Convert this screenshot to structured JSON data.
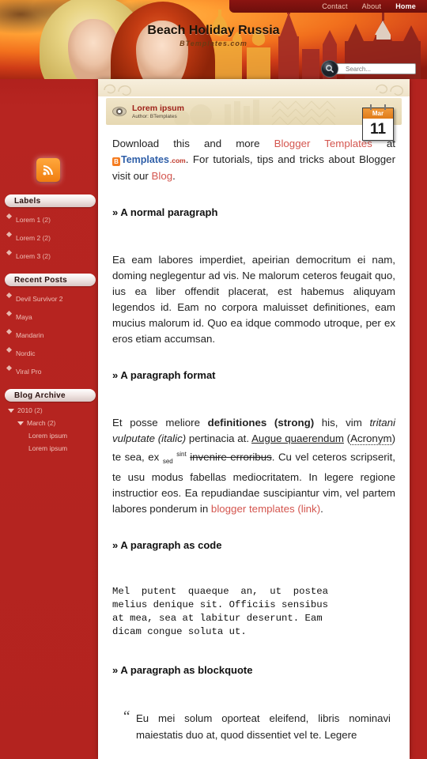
{
  "topnav": {
    "items": [
      {
        "label": "Contact",
        "active": false
      },
      {
        "label": "About",
        "active": false
      },
      {
        "label": "Home",
        "active": true
      }
    ]
  },
  "header": {
    "blog_title": "Beach Holiday Russia",
    "blog_subtitle": "BTemplates.com",
    "search_placeholder": "Search...",
    "search_value": "",
    "rss_icon": "rss-icon",
    "search_icon": "search-icon"
  },
  "sidebar": {
    "labels": {
      "title": "Labels",
      "items": [
        {
          "label": "Lorem 1",
          "count": "(2)"
        },
        {
          "label": "Lorem 2",
          "count": "(2)"
        },
        {
          "label": "Lorem 3",
          "count": "(2)"
        }
      ]
    },
    "recent_posts": {
      "title": "Recent Posts",
      "items": [
        {
          "label": "Devil Survivor 2"
        },
        {
          "label": "Maya"
        },
        {
          "label": "Mandarin"
        },
        {
          "label": "Nordic"
        },
        {
          "label": "Viral Pro"
        }
      ]
    },
    "blog_archive": {
      "title": "Blog Archive",
      "year": "2010",
      "year_count": "(2)",
      "month": "March",
      "month_count": "(2)",
      "posts": [
        {
          "label": "Lorem ipsum"
        },
        {
          "label": "Lorem ipsum"
        }
      ]
    }
  },
  "post": {
    "title": "Lorem ipsum",
    "author": "Author: BTemplates",
    "date": {
      "month": "Mar",
      "day": "11"
    },
    "intro": {
      "p1_a": "Download this and more ",
      "p1_link1": "Blogger Templates",
      "p1_b": " at ",
      "logo_mark": "B",
      "logo_name": "Templates",
      "logo_tld": ".com",
      "p1_c": ". For tutorials, tips and tricks about Blogger visit our ",
      "p1_link2": "Blog",
      "p1_d": "."
    },
    "sections": [
      {
        "heading": "» A normal paragraph",
        "body": "Ea eam labores imperdiet, apeirian democritum ei nam, doming neglegentur ad vis. Ne malorum ceteros feugait quo, ius ea liber offendit placerat, est habemus aliquyam legendos id. Eam no corpora maluisset definitiones, eam mucius malorum id. Quo ea idque commodo utroque, per ex eros etiam accumsan."
      },
      {
        "heading": "» A paragraph format",
        "f1": "Et posse meliore ",
        "f_strong": "definitiones (strong)",
        "f2": " his, vim ",
        "f_italic": "tritani vulputate (italic)",
        "f3": " pertinacia at. ",
        "f_underline": "Augue quaerendum",
        "f4": " (",
        "f_acronym": "Acronym",
        "f5": ") te sea, ex ",
        "f_sub": "sed",
        "f6": " ",
        "f_sup": "sint",
        "f7": " ",
        "f_strike": "invenire erroribus",
        "f8": ". Cu vel ceteros scripserit, te usu modus fabellas mediocritatem. In legere regione instructior eos. Ea repudiandae suscipiantur vim, vel partem labores ponderum in ",
        "f_link": "blogger templates (link)",
        "f9": "."
      },
      {
        "heading": "» A paragraph as code",
        "code": "Mel  putent  quaeque  an,  ut  postea\nmelius denique sit. Officiis sensibus\nat mea, sea at labitur deserunt. Eam\ndicam congue soluta ut."
      },
      {
        "heading": "» A paragraph as blockquote",
        "quote_mark": "“",
        "quote": "Eu mei solum oporteat eleifend, libris nominavi maiestatis duo at, quod dissentiet vel te. Legere"
      }
    ]
  },
  "colors": {
    "page_bg": "#b3231f",
    "accent_link": "#d4564f",
    "post_title": "#9d1f18",
    "calendar_header": "#e07b18",
    "rss_orange": "#f07d10"
  }
}
